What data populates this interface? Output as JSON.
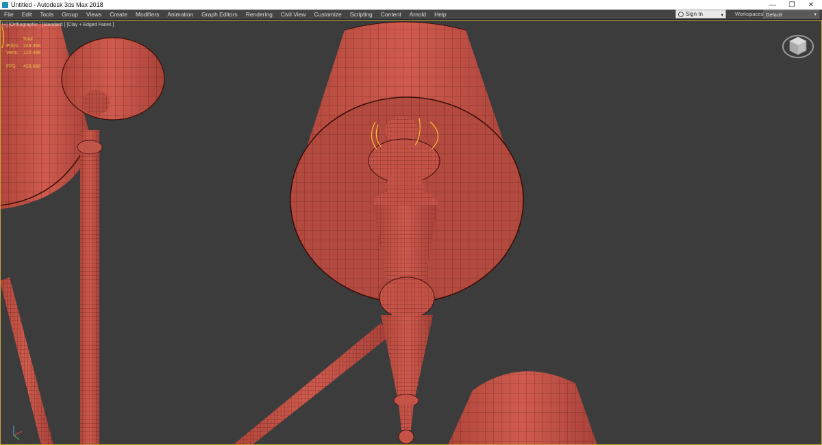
{
  "titlebar": {
    "title": "Untitled - Autodesk 3ds Max 2018",
    "minimize_glyph": "—",
    "restore_glyph": "❐",
    "close_glyph": "✕"
  },
  "menubar": {
    "items": [
      "File",
      "Edit",
      "Tools",
      "Group",
      "Views",
      "Create",
      "Modifiers",
      "Animation",
      "Graph Editors",
      "Rendering",
      "Civil View",
      "Customize",
      "Scripting",
      "Content",
      "Arnold",
      "Help"
    ]
  },
  "account": {
    "signin_label": "Sign In",
    "dropdown_glyph": "▾"
  },
  "workspaces": {
    "label": "Workspaces:",
    "value": "Default",
    "dropdown_glyph": "▾"
  },
  "viewport": {
    "label": "[+] [Orthographic ] [Standard ] [Clay + Edged Faces ]",
    "stats": {
      "total_label": "Total",
      "polys_label": "Polys:",
      "polys_value": "249 394",
      "verts_label": "Verts:",
      "verts_value": "123 499",
      "fps_label": "FPS:",
      "fps_value": "433,088"
    }
  },
  "colors": {
    "viewport_bg": "#3c3c3c",
    "mesh_fill": "#c65347",
    "wire": "#3a0d08",
    "selection": "#ffc233",
    "menubar_bg": "#444444"
  },
  "icons": {
    "app": "3dsmax-logo-icon",
    "user": "user-icon",
    "viewcube": "viewcube-icon",
    "axis": "axis-tripod-icon"
  }
}
